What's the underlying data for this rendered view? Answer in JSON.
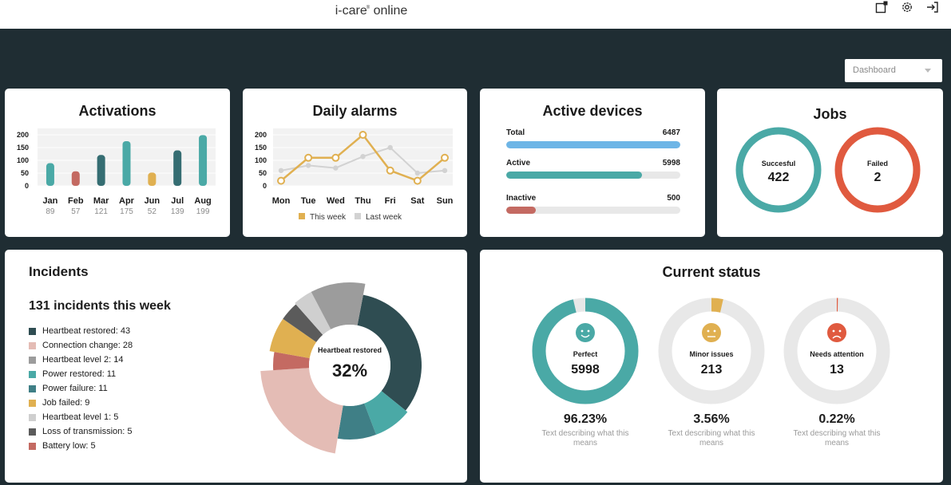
{
  "topbar": {
    "brand_prefix": "i-care",
    "brand_reg": "®",
    "brand_suffix": "online"
  },
  "icons": {
    "export": "export-icon",
    "settings": "gear-icon",
    "logout": "logout-icon"
  },
  "filter": {
    "selected": "Dashboard"
  },
  "colors": {
    "teal": "#4aa9a6",
    "dark_teal": "#356d72",
    "red": "#e05a3f",
    "rose": "#c46a62",
    "amber": "#e0b051",
    "blue": "#6eb5e6",
    "grey": "#d2d2d2",
    "dark_bg": "#1f2d33"
  },
  "activations": {
    "title": "Activations",
    "chart_data": {
      "type": "bar",
      "categories": [
        "Jan",
        "Feb",
        "Mar",
        "Apr",
        "Jun",
        "Jul",
        "Aug"
      ],
      "values": [
        89,
        57,
        121,
        175,
        52,
        139,
        199
      ],
      "colors": [
        "#4aa9a6",
        "#c46a62",
        "#356d72",
        "#4aa9a6",
        "#e0b051",
        "#356d72",
        "#4aa9a6"
      ],
      "yticks": [
        "200",
        "150",
        "100",
        "50",
        "0"
      ],
      "ylim": [
        0,
        200
      ]
    }
  },
  "daily_alarms": {
    "title": "Daily alarms",
    "chart_data": {
      "type": "line",
      "categories": [
        "Mon",
        "Tue",
        "Wed",
        "Thu",
        "Fri",
        "Sat",
        "Sun"
      ],
      "yticks": [
        "200",
        "150",
        "100",
        "50",
        "0"
      ],
      "ylim": [
        0,
        200
      ],
      "series": [
        {
          "name": "This week",
          "color": "#e0b051",
          "values": [
            20,
            110,
            110,
            200,
            60,
            20,
            110
          ]
        },
        {
          "name": "Last week",
          "color": "#d2d2d2",
          "values": [
            60,
            80,
            70,
            115,
            150,
            50,
            60
          ]
        }
      ]
    }
  },
  "active_devices": {
    "title": "Active devices",
    "rows": [
      {
        "label": "Total",
        "value": "6487",
        "fraction": 1.0,
        "color": "#6eb5e6"
      },
      {
        "label": "Active",
        "value": "5998",
        "fraction": 0.78,
        "color": "#4aa9a6"
      },
      {
        "label": "Inactive",
        "value": "500",
        "fraction": 0.17,
        "color": "#c46a62"
      }
    ]
  },
  "jobs": {
    "title": "Jobs",
    "success": {
      "label": "Succesful",
      "value": "422",
      "color": "#4aa9a6"
    },
    "failed": {
      "label": "Failed",
      "value": "2",
      "color": "#e05a3f"
    }
  },
  "incidents": {
    "title": "Incidents",
    "subtitle": "131 incidents this week",
    "legend": [
      {
        "label": "Heartbeat restored: 43",
        "color": "#2f4d52"
      },
      {
        "label": "Connection change: 28",
        "color": "#e4bcb5"
      },
      {
        "label": "Heartbeat level 2: 14",
        "color": "#9c9c9c"
      },
      {
        "label": "Power restored: 11",
        "color": "#4aa9a6"
      },
      {
        "label": "Power failure: 11",
        "color": "#3f7f86"
      },
      {
        "label": "Job failed: 9",
        "color": "#e0b051"
      },
      {
        "label": "Heartbeat level 1: 5",
        "color": "#cfcfcf"
      },
      {
        "label": "Loss of transmission: 5",
        "color": "#5b5b5b"
      },
      {
        "label": "Battery low: 5",
        "color": "#c46a62"
      }
    ],
    "center_label": "Heartbeat restored",
    "center_value": "32%",
    "chart_data": {
      "type": "pie",
      "categories": [
        "Heartbeat restored",
        "Connection change",
        "Heartbeat level 2",
        "Power restored",
        "Power failure",
        "Job failed",
        "Heartbeat level 1",
        "Loss of transmission",
        "Battery low"
      ],
      "values": [
        43,
        28,
        14,
        11,
        11,
        9,
        5,
        5,
        5
      ]
    }
  },
  "current_status": {
    "title": "Current status",
    "items": [
      {
        "label": "Perfect",
        "value": "5998",
        "percent": "96.23%",
        "fraction": 0.9623,
        "color": "#4aa9a6",
        "face": "happy-face-icon",
        "desc": "Text describing what this means"
      },
      {
        "label": "Minor issues",
        "value": "213",
        "percent": "3.56%",
        "fraction": 0.0356,
        "color": "#e0b051",
        "face": "neutral-face-icon",
        "desc": "Text describing what this means"
      },
      {
        "label": "Needs attention",
        "value": "13",
        "percent": "0.22%",
        "fraction": 0.0022,
        "color": "#e05a3f",
        "face": "sad-face-icon",
        "desc": "Text describing what this means"
      }
    ]
  }
}
